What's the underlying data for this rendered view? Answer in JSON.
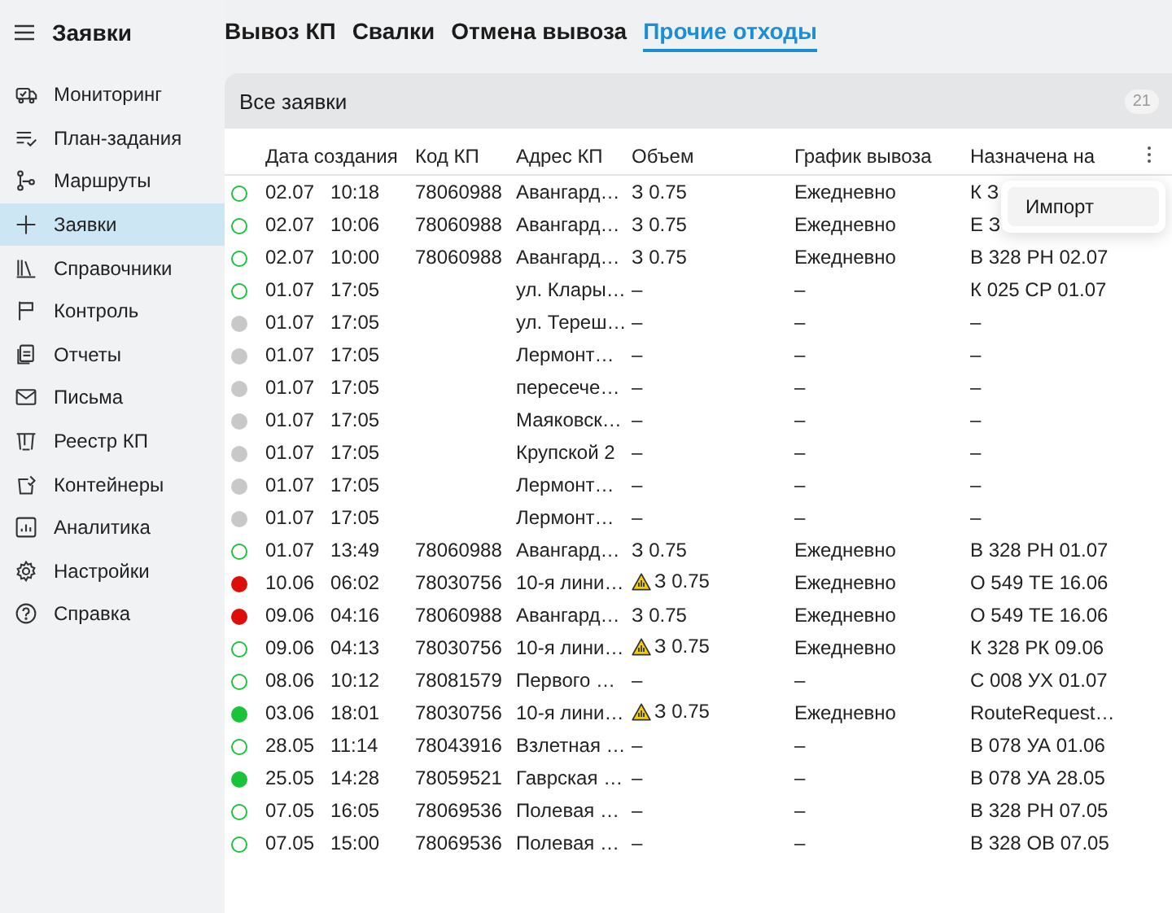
{
  "app_title": "Заявки",
  "sidebar": {
    "items": [
      {
        "label": "Мониторинг",
        "selected": false
      },
      {
        "label": "План-задания",
        "selected": false
      },
      {
        "label": "Маршруты",
        "selected": false
      },
      {
        "label": "Заявки",
        "selected": true
      },
      {
        "label": "Справочники",
        "selected": false
      },
      {
        "label": "Контроль",
        "selected": false
      },
      {
        "label": "Отчеты",
        "selected": false
      },
      {
        "label": "Письма",
        "selected": false
      },
      {
        "label": "Реестр КП",
        "selected": false
      },
      {
        "label": "Контейнеры",
        "selected": false
      },
      {
        "label": "Аналитика",
        "selected": false
      },
      {
        "label": "Настройки",
        "selected": false
      },
      {
        "label": "Справка",
        "selected": false
      }
    ]
  },
  "tabs": [
    {
      "label": "Вывоз КП",
      "selected": false
    },
    {
      "label": "Свалки",
      "selected": false
    },
    {
      "label": "Отмена вывоза",
      "selected": false
    },
    {
      "label": "Прочие отходы",
      "selected": true
    }
  ],
  "panel": {
    "title": "Все заявки",
    "count": "21"
  },
  "table": {
    "columns": [
      "Дата создания",
      "Код КП",
      "Адрес КП",
      "Объем",
      "График вывоза",
      "Назначена на"
    ],
    "rows": [
      {
        "kind": "ring",
        "color": "#19c43a",
        "date": "02.07",
        "time": "10:18",
        "code": "78060988",
        "address": "Авангард…",
        "warning": false,
        "volume": "З 0.75",
        "schedule": "Ежедневно",
        "assigned": "К З"
      },
      {
        "kind": "ring",
        "color": "#19c43a",
        "date": "02.07",
        "time": "10:06",
        "code": "78060988",
        "address": "Авангард…",
        "warning": false,
        "volume": "З 0.75",
        "schedule": "Ежедневно",
        "assigned": "Е З"
      },
      {
        "kind": "ring",
        "color": "#19c43a",
        "date": "02.07",
        "time": "10:00",
        "code": "78060988",
        "address": "Авангард…",
        "warning": false,
        "volume": "З 0.75",
        "schedule": "Ежедневно",
        "assigned": "В 328 РН 02.07"
      },
      {
        "kind": "ring",
        "color": "#19c43a",
        "date": "01.07",
        "time": "17:05",
        "address": "ул. Клары…",
        "warning": false,
        "volume": "–",
        "schedule": "–",
        "assigned": "К 025 СР 01.07"
      },
      {
        "kind": "dot",
        "color": "#c8c8c8",
        "date": "01.07",
        "time": "17:05",
        "address": "ул. Тереш…",
        "warning": false,
        "volume": "–",
        "schedule": "–",
        "assigned": "–"
      },
      {
        "kind": "dot",
        "color": "#c8c8c8",
        "date": "01.07",
        "time": "17:05",
        "address": "Лермонт…",
        "warning": false,
        "volume": "–",
        "schedule": "–",
        "assigned": "–"
      },
      {
        "kind": "dot",
        "color": "#c8c8c8",
        "date": "01.07",
        "time": "17:05",
        "address": "пересече…",
        "warning": false,
        "volume": "–",
        "schedule": "–",
        "assigned": "–"
      },
      {
        "kind": "dot",
        "color": "#c8c8c8",
        "date": "01.07",
        "time": "17:05",
        "address": "Маяковск…",
        "warning": false,
        "volume": "–",
        "schedule": "–",
        "assigned": "–"
      },
      {
        "kind": "dot",
        "color": "#c8c8c8",
        "date": "01.07",
        "time": "17:05",
        "address": "Крупской 2",
        "warning": false,
        "volume": "–",
        "schedule": "–",
        "assigned": "–"
      },
      {
        "kind": "dot",
        "color": "#c8c8c8",
        "date": "01.07",
        "time": "17:05",
        "address": "Лермонт…",
        "warning": false,
        "volume": "–",
        "schedule": "–",
        "assigned": "–"
      },
      {
        "kind": "dot",
        "color": "#c8c8c8",
        "date": "01.07",
        "time": "17:05",
        "address": "Лермонт…",
        "warning": false,
        "volume": "–",
        "schedule": "–",
        "assigned": "–"
      },
      {
        "kind": "ring",
        "color": "#19c43a",
        "date": "01.07",
        "time": "13:49",
        "code": "78060988",
        "address": "Авангард…",
        "warning": false,
        "volume": "З 0.75",
        "schedule": "Ежедневно",
        "assigned": "В 328 РН 01.07"
      },
      {
        "kind": "dot",
        "color": "#dd0f0a",
        "date": "10.06",
        "time": "06:02",
        "code": "78030756",
        "address": "10-я лини…",
        "warning": true,
        "volume": "З 0.75",
        "schedule": "Ежедневно",
        "assigned": "О 549 ТЕ 16.06"
      },
      {
        "kind": "dot",
        "color": "#dd0f0a",
        "date": "09.06",
        "time": "04:16",
        "code": "78060988",
        "address": "Авангард…",
        "warning": false,
        "volume": "З 0.75",
        "schedule": "Ежедневно",
        "assigned": "О 549 ТЕ 16.06"
      },
      {
        "kind": "ring",
        "color": "#19c43a",
        "date": "09.06",
        "time": "04:13",
        "code": "78030756",
        "address": "10-я лини…",
        "warning": true,
        "volume": "З 0.75",
        "schedule": "Ежедневно",
        "assigned": "К 328 РК 09.06"
      },
      {
        "kind": "ring",
        "color": "#19c43a",
        "date": "08.06",
        "time": "10:12",
        "code": "78081579",
        "address": "Первого …",
        "warning": false,
        "volume": "–",
        "schedule": "–",
        "assigned": "С 008 УХ 01.07"
      },
      {
        "kind": "dot",
        "color": "#19c43a",
        "date": "03.06",
        "time": "18:01",
        "code": "78030756",
        "address": "10-я лини…",
        "warning": true,
        "volume": "З 0.75",
        "schedule": "Ежедневно",
        "assigned": "RouteRequest…"
      },
      {
        "kind": "ring",
        "color": "#19c43a",
        "date": "28.05",
        "time": "11:14",
        "code": "78043916",
        "address": "Взлетная …",
        "warning": false,
        "volume": "–",
        "schedule": "–",
        "assigned": "В 078 УА 01.06"
      },
      {
        "kind": "dot",
        "color": "#19c43a",
        "date": "25.05",
        "time": "14:28",
        "code": "78059521",
        "address": "Гаврская …",
        "warning": false,
        "volume": "–",
        "schedule": "–",
        "assigned": "В 078 УА 28.05"
      },
      {
        "kind": "ring",
        "color": "#19c43a",
        "date": "07.05",
        "time": "16:05",
        "code": "78069536",
        "address": "Полевая …",
        "warning": false,
        "volume": "–",
        "schedule": "–",
        "assigned": "В 328 РН 07.05"
      },
      {
        "kind": "ring",
        "color": "#19c43a",
        "date": "07.05",
        "time": "15:00",
        "code": "78069536",
        "address": "Полевая …",
        "warning": false,
        "volume": "–",
        "schedule": "–",
        "assigned": "В 328 ОВ 07.05"
      }
    ]
  },
  "menu": {
    "items": [
      "Импорт"
    ]
  }
}
